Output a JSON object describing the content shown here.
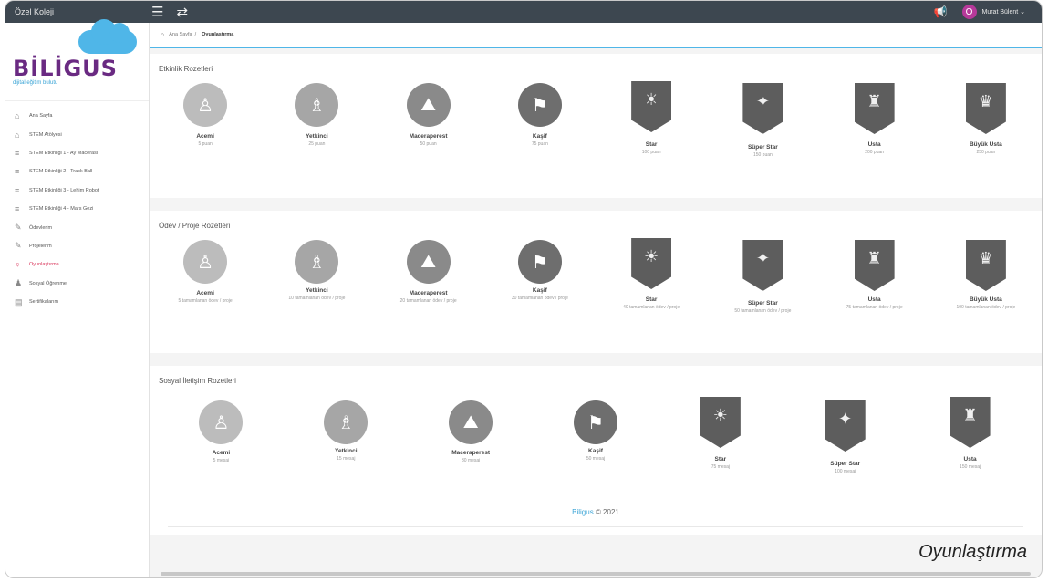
{
  "topbar": {
    "school": "Özel Koleji",
    "user": "Murat Bülent",
    "user_initial": "O"
  },
  "sidebar": {
    "brand": "BİLİGUS",
    "tagline": "dijital eğitim bulutu",
    "items": [
      {
        "label": "Ana Sayfa",
        "icon": "home-icon"
      },
      {
        "label": "STEM Atölyesi",
        "icon": "home-icon"
      },
      {
        "label": "STEM Etkinliği 1 - Ay Macerası",
        "icon": "list-icon"
      },
      {
        "label": "STEM Etkinliği 2 - Track Ball",
        "icon": "list-icon"
      },
      {
        "label": "STEM Etkinliği 3 - Lehim Robot",
        "icon": "list-icon"
      },
      {
        "label": "STEM Etkinliği 4 - Mars Gezi",
        "icon": "list-icon"
      },
      {
        "label": "Ödevlerim",
        "icon": "edit-icon"
      },
      {
        "label": "Projelerim",
        "icon": "edit-icon"
      },
      {
        "label": "Oyunlaştırma",
        "icon": "trophy-icon",
        "active": true
      },
      {
        "label": "Sosyal Öğrenme",
        "icon": "user-icon"
      },
      {
        "label": "Sertifikalarım",
        "icon": "certificate-icon"
      }
    ]
  },
  "breadcrumb": {
    "home": "Ana Sayfa",
    "sep": "/",
    "current": "Oyunlaştırma"
  },
  "sections": {
    "etkinlik": {
      "title": "Etkinlik Rozetleri",
      "badges": [
        {
          "name": "Acemi",
          "sub": "5 puan"
        },
        {
          "name": "Yetkinci",
          "sub": "25 puan"
        },
        {
          "name": "Maceraperest",
          "sub": "50 puan"
        },
        {
          "name": "Kaşif",
          "sub": "75 puan"
        },
        {
          "name": "Star",
          "sub": "100 puan"
        },
        {
          "name": "Süper Star",
          "sub": "150 puan"
        },
        {
          "name": "Usta",
          "sub": "200 puan"
        },
        {
          "name": "Büyük Usta",
          "sub": "250 puan"
        }
      ]
    },
    "odev": {
      "title": "Ödev / Proje Rozetleri",
      "badges": [
        {
          "name": "Acemi",
          "sub": "5 tamamlanan ödev / proje"
        },
        {
          "name": "Yetkinci",
          "sub": "10 tamamlanan ödev / proje"
        },
        {
          "name": "Maceraperest",
          "sub": "20 tamamlanan ödev / proje"
        },
        {
          "name": "Kaşif",
          "sub": "30 tamamlanan ödev / proje"
        },
        {
          "name": "Star",
          "sub": "40 tamamlanan ödev / proje"
        },
        {
          "name": "Süper Star",
          "sub": "50 tamamlanan ödev / proje"
        },
        {
          "name": "Usta",
          "sub": "75 tamamlanan ödev / proje"
        },
        {
          "name": "Büyük Usta",
          "sub": "100 tamamlanan ödev / proje"
        }
      ]
    },
    "sosyal": {
      "title": "Sosyal İletişim Rozetleri",
      "badges": [
        {
          "name": "Acemi",
          "sub": "5 mesaj"
        },
        {
          "name": "Yetkinci",
          "sub": "15 mesaj"
        },
        {
          "name": "Maceraperest",
          "sub": "30 mesaj"
        },
        {
          "name": "Kaşif",
          "sub": "50 mesaj"
        },
        {
          "name": "Star",
          "sub": "75 mesaj"
        },
        {
          "name": "Süper Star",
          "sub": "100 mesaj"
        },
        {
          "name": "Usta",
          "sub": "150 mesaj"
        }
      ]
    }
  },
  "footer": {
    "brand": "Biligus",
    "copy": "© 2021"
  },
  "caption": "Oyunlaştırma",
  "colors": {
    "topbar": "#3d4750",
    "accent": "#4fb6e8",
    "brand": "#6a2a82",
    "active": "#d9345a"
  }
}
